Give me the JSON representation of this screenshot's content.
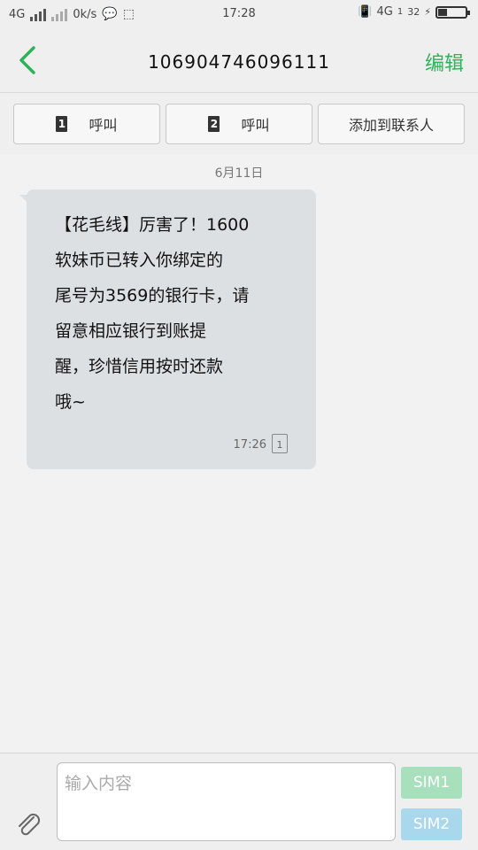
{
  "status_bar": {
    "network_left": "4G",
    "speed": "0k/s",
    "time": "17:28",
    "network_right": "4G",
    "sim_index": "1",
    "battery": "32",
    "battery_level": 0.32
  },
  "header": {
    "title": "106904746096111",
    "edit_label": "编辑"
  },
  "actions": {
    "call1_sim": "1",
    "call1_label": "呼叫",
    "call2_sim": "2",
    "call2_label": "呼叫",
    "add_contact_label": "添加到联系人"
  },
  "conversation": {
    "date": "6月11日",
    "message": {
      "lines": [
        "【花毛线】厉害了！1600",
        "软妹币已转入你绑定的",
        "尾号为3569的银行卡，请",
        "留意相应银行到账提",
        "醒，珍惜信用按时还款",
        "哦~"
      ],
      "time": "17:26",
      "sim": "1"
    }
  },
  "composer": {
    "placeholder": "输入内容",
    "sim1_label": "SIM1",
    "sim2_label": "SIM2",
    "sim1_color": "#a8e0bd",
    "sim2_color": "#a9d8ec"
  },
  "colors": {
    "accent": "#2fb35a"
  }
}
